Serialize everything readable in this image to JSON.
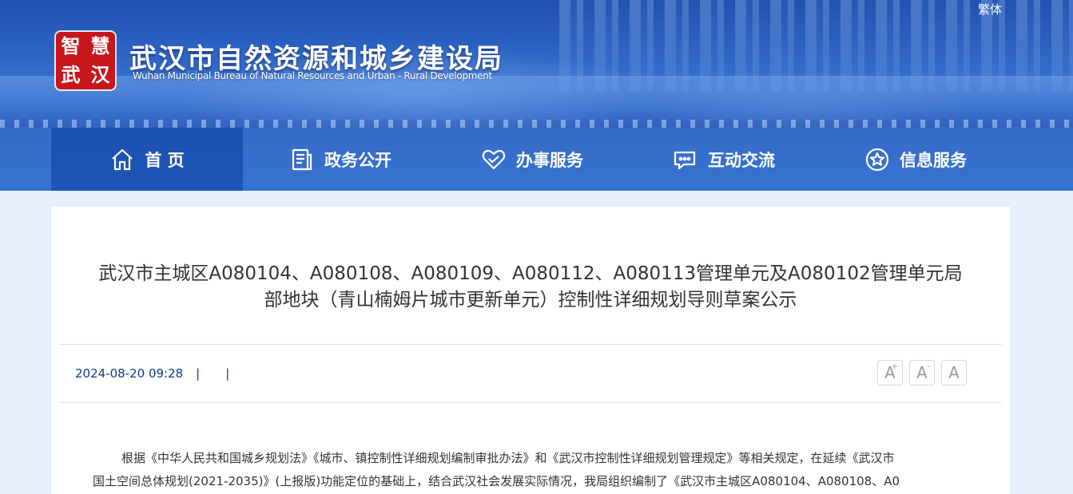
{
  "header": {
    "lang_switch": "繁体",
    "logo_chars": [
      "智",
      "慧",
      "武",
      "汉"
    ],
    "title": "武汉市自然资源和城乡建设局",
    "subtitle": "Wuhan Municipal Bureau of Natural Resources and Urban - Rural Development"
  },
  "nav": {
    "items": [
      {
        "label": "首 页",
        "icon": "home-icon"
      },
      {
        "label": "政务公开",
        "icon": "document-list-icon"
      },
      {
        "label": "办事服务",
        "icon": "heart-icon"
      },
      {
        "label": "互动交流",
        "icon": "chat-icon"
      },
      {
        "label": "信息服务",
        "icon": "star-circle-icon"
      }
    ]
  },
  "article": {
    "title_line1": "武汉市主城区A080104、A080108、A080109、A080112、A080113管理单元及A080102管理单元局",
    "title_line2": "部地块（青山楠姆片城市更新单元）控制性详细规划导则草案公示",
    "date": "2024-08-20 09:28",
    "sep1": "|",
    "sep2": "|",
    "font_large": "A",
    "font_large_mark": "+",
    "font_small": "A",
    "font_small_mark": "-",
    "font_reset": "A",
    "paragraph_line1": "根据《中华人民共和国城乡规划法》《城市、镇控制性详细规划编制审批办法》和《武汉市控制性详细规划管理规定》等相关规定，在延续《武汉市",
    "paragraph_line2": "国土空间总体规划(2021-2035)》(上报版)功能定位的基础上，结合武汉社会发展实际情况，我局组织编制了《武汉市主城区A080104、A080108、A0"
  },
  "colors": {
    "nav_bg": "#2e6ccd",
    "page_bg": "#e6effb",
    "meta_text": "#0a3d86",
    "seal_red": "#c8161d"
  }
}
